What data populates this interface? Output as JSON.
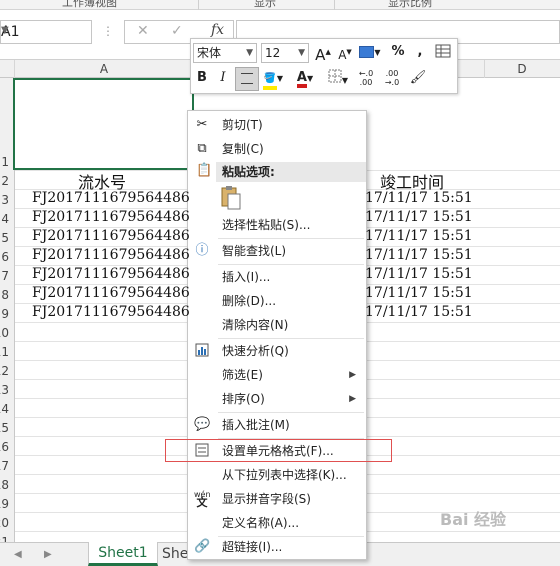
{
  "ribbon": {
    "groups": [
      "工作簿视图",
      "显示",
      "显示比例"
    ]
  },
  "formula_bar": {
    "name_box": "A1",
    "fx": "fx",
    "cancel": "✕",
    "enter": "✓"
  },
  "columns": [
    "A",
    "D"
  ],
  "rows": [
    "1",
    "2",
    "3",
    "4",
    "5",
    "6",
    "7",
    "8",
    "9",
    "10",
    "11",
    "12",
    "13",
    "14",
    "15",
    "16",
    "17",
    "18",
    "19",
    "20",
    "21"
  ],
  "sheet": {
    "header_a": "流水号",
    "header_d": "竣工时间",
    "ids": [
      "FJ2017111679564486",
      "FJ2017111679564486",
      "FJ2017111679564486",
      "FJ2017111679564486",
      "FJ2017111679564486",
      "FJ2017111679564486",
      "FJ2017111679564486"
    ],
    "times": [
      "17/11/17 15:51",
      "17/11/17 15:51",
      "17/11/17 15:51",
      "17/11/17 15:51",
      "17/11/17 15:51",
      "17/11/17 15:51",
      "17/11/17 15:51"
    ]
  },
  "tabs": {
    "sheet1": "Sheet1",
    "sheet2": "She"
  },
  "mini_toolbar": {
    "font_name": "宋体",
    "font_size": "12",
    "grow": "A",
    "shrink": "A",
    "percent": "%",
    "comma": ",",
    "bold": "B",
    "italic": "I",
    "font_color_letter": "A",
    "dec_more": "←.0\n.00",
    "dec_less": ".00\n→.0"
  },
  "menu": {
    "cut": "剪切(T)",
    "copy": "复制(C)",
    "paste_options": "粘贴选项:",
    "paste_special": "选择性粘贴(S)...",
    "smart_lookup": "智能查找(L)",
    "insert": "插入(I)...",
    "delete": "删除(D)...",
    "clear": "清除内容(N)",
    "quick_analysis": "快速分析(Q)",
    "filter": "筛选(E)",
    "sort": "排序(O)",
    "insert_comment": "插入批注(M)",
    "format_cells": "设置单元格格式(F)...",
    "pick_list": "从下拉列表中选择(K)...",
    "phonetic": "显示拼音字段(S)",
    "define_name": "定义名称(A)...",
    "hyperlink": "超链接(I)...",
    "phonetic_icon_text": "wén"
  },
  "watermark": "Bai 经验",
  "colors": {
    "accent": "#217346",
    "highlight": "#e05050"
  }
}
